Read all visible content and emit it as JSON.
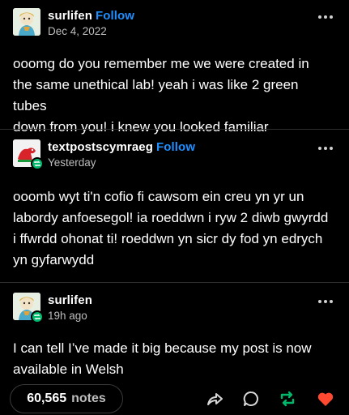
{
  "posts": [
    {
      "blog_name": "surlifen",
      "follow_label": "Follow",
      "timestamp": "Dec 4, 2022",
      "lines": [
        "ooomg do you remember me we were created in",
        "the same unethical lab! yeah i was like 2 green tubes",
        "down from you! i knew you looked familiar"
      ]
    },
    {
      "blog_name": "textpostscymraeg",
      "follow_label": "Follow",
      "timestamp": "Yesterday",
      "lines": [
        "ooomb wyt ti'n cofio fi cawsom ein creu yn yr un",
        "labordy anfoesegol! ia roeddwn i ryw 2 diwb gwyrdd",
        "i ffwrdd ohonat ti! roeddwn yn sicr dy fod yn edrych",
        "yn gyfarwydd"
      ]
    },
    {
      "blog_name": "surlifen",
      "timestamp": "19h ago",
      "lines": [
        "I can tell I’ve made it big because my post is now",
        "available in Welsh"
      ]
    }
  ],
  "footer": {
    "notes_count": "60,565",
    "notes_label": "notes"
  },
  "colors": {
    "follow": "#1f8fff",
    "reblog": "#00b86b",
    "like": "#ff4930",
    "background": "#000000"
  },
  "icons": {
    "more": "more-dots-icon",
    "share": "share-icon",
    "reply": "reply-icon",
    "reblog": "reblog-icon",
    "like": "heart-icon"
  }
}
